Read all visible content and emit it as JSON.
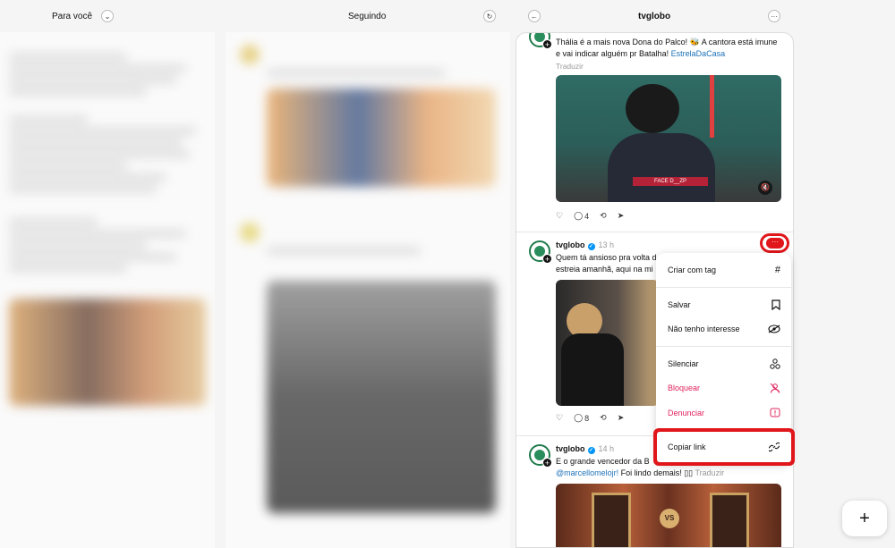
{
  "headers": {
    "for_you": "Para você",
    "following": "Seguindo",
    "profile": "tvglobo"
  },
  "post1": {
    "text": "Thália é a mais nova Dona do Palco! 🐝 A cantora está imune e vai indicar alguém pr Batalha!",
    "hashtag": "EstrelaDaCasa",
    "translate": "Traduzir",
    "image_caption": "FACE D__ZP",
    "comments": "4"
  },
  "post2": {
    "user": "tvglobo",
    "time": "13 h",
    "text_line1": "Quem tá ansioso pra volta d",
    "text_line2": "estreia amanhã, aqui na mi",
    "comments": "8"
  },
  "post3": {
    "user": "tvglobo",
    "time": "14 h",
    "text_line1": "E o grande vencedor da B",
    "mention": "@marcellomelojr!",
    "text_after": "Foi lindo demais! ▯▯",
    "translate": "Traduzir"
  },
  "menu": {
    "items": [
      {
        "label": "Criar com tag",
        "icon": "hashtag-icon",
        "glyph": "#"
      },
      {
        "label": "Salvar",
        "icon": "bookmark-icon",
        "glyph": "⛉"
      },
      {
        "label": "Não tenho interesse",
        "icon": "eye-off-icon",
        "glyph": "◎"
      },
      {
        "label": "Silenciar",
        "icon": "mute-icon",
        "glyph": "⚇"
      },
      {
        "label": "Bloquear",
        "icon": "block-user-icon",
        "glyph": "⚲"
      },
      {
        "label": "Denunciar",
        "icon": "report-icon",
        "glyph": "!"
      },
      {
        "label": "Copiar link",
        "icon": "link-icon",
        "glyph": "🔗"
      }
    ]
  },
  "colors": {
    "danger": "#e0245e",
    "highlight": "#e0161b",
    "link": "#1d72b8",
    "verified": "#0095f6"
  }
}
